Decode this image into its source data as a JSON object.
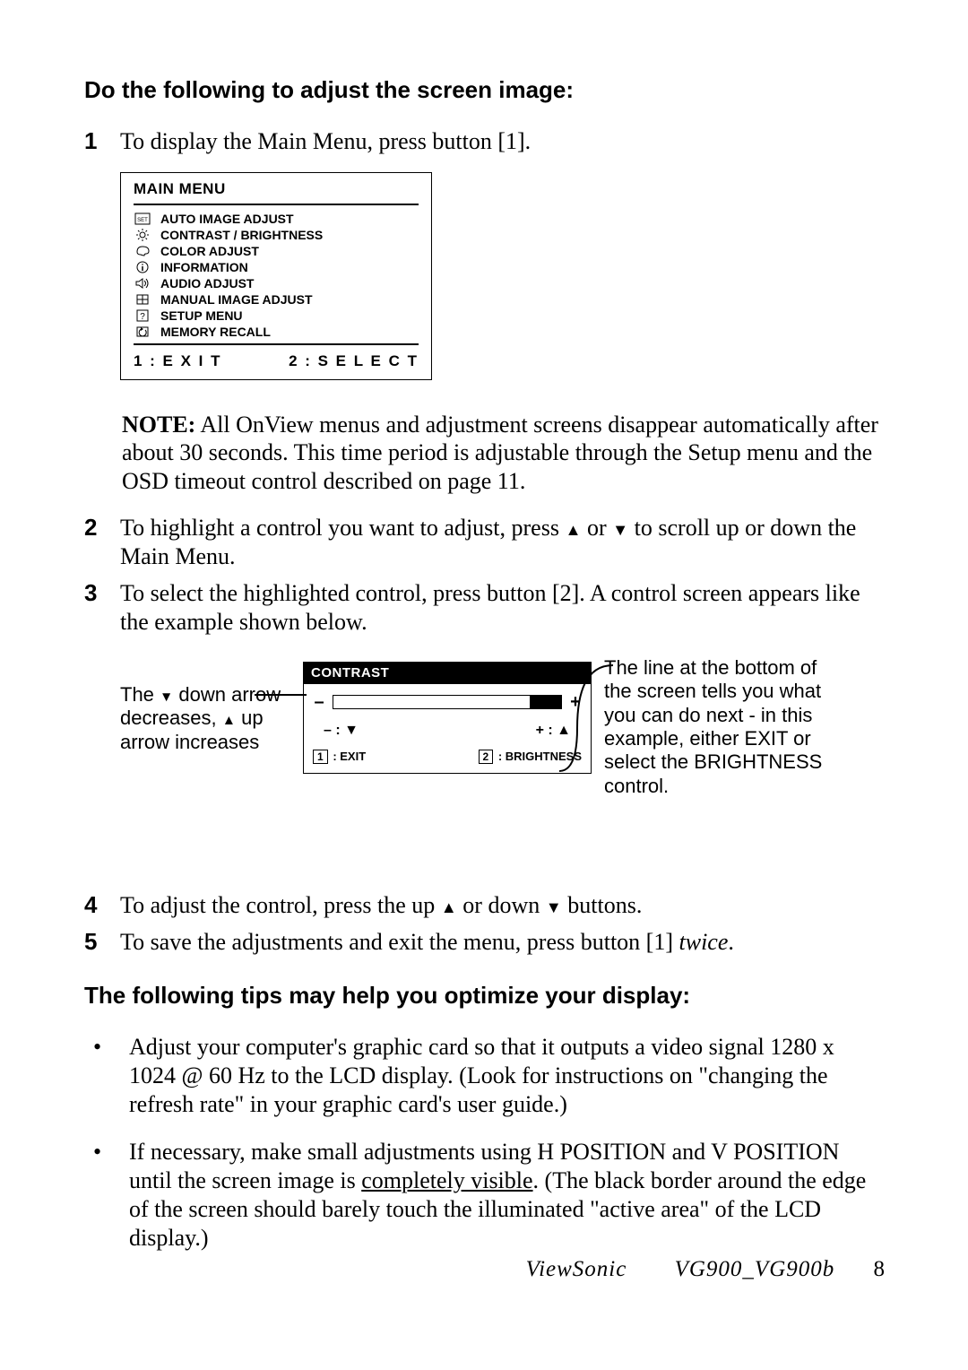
{
  "headings": {
    "adjust": "Do the following to adjust the screen image:",
    "tips": "The following tips may help you optimize your display:"
  },
  "steps": {
    "s1": "To display the Main Menu, press button [1].",
    "note_label": "NOTE:",
    "note_text": " All OnView menus and adjustment screens disappear automatically after about 30 seconds. This time period is adjustable through the Setup menu and the OSD timeout control described on page 11.",
    "s2_a": "To highlight a control you want to adjust, press ",
    "s2_b": " or ",
    "s2_c": " to scroll up or down the Main Menu.",
    "s3": "To select the highlighted control, press button [2]. A control screen appears like the example shown below.",
    "s4_a": "To adjust the control, press the up ",
    "s4_b": " or down ",
    "s4_c": " buttons.",
    "s5_a": "To save the adjustments and exit the menu, press button [1] ",
    "s5_b": "twice",
    "s5_c": "."
  },
  "nums": {
    "n1": "1",
    "n2": "2",
    "n3": "3",
    "n4": "4",
    "n5": "5"
  },
  "menu": {
    "title": "MAIN MENU",
    "items": [
      "AUTO IMAGE ADJUST",
      "CONTRAST / BRIGHTNESS",
      "COLOR ADJUST",
      "INFORMATION",
      "AUDIO ADJUST",
      "MANUAL IMAGE ADJUST",
      "SETUP MENU",
      "MEMORY RECALL"
    ],
    "footer_left": "1 : E X I T",
    "footer_right": "2 : S E L E C T"
  },
  "diagram": {
    "left_a": "The ",
    "left_b": " down arrow decreases, ",
    "left_c": " up arrow increases",
    "right": "The line at the bottom of the screen tells you what you can do next - in this example, either EXIT or select the BRIGHTNESS control.",
    "contrast_title": "CONTRAST",
    "minus": "–",
    "plus": "+",
    "down_decr": "– : ▼",
    "up_incr": "+ : ▲",
    "foot_1_num": "1",
    "foot_1_txt": ": EXIT",
    "foot_2_num": "2",
    "foot_2_txt": ": BRIGHTNESS"
  },
  "tips": {
    "t1": "Adjust your computer's graphic card so that it outputs a video signal 1280 x 1024 @ 60 Hz to the LCD display. (Look for instructions on \"changing the refresh rate\" in your graphic card's user guide.)",
    "t2_a": "If necessary, make small adjustments using H POSITION and V POSITION until the screen image is ",
    "t2_b": "completely visible",
    "t2_c": ". (The black border around the edge of the screen should barely touch the illuminated \"active area\" of the LCD display.)"
  },
  "footer": {
    "brand": "ViewSonic",
    "model": "VG900_VG900b",
    "page": "8"
  }
}
